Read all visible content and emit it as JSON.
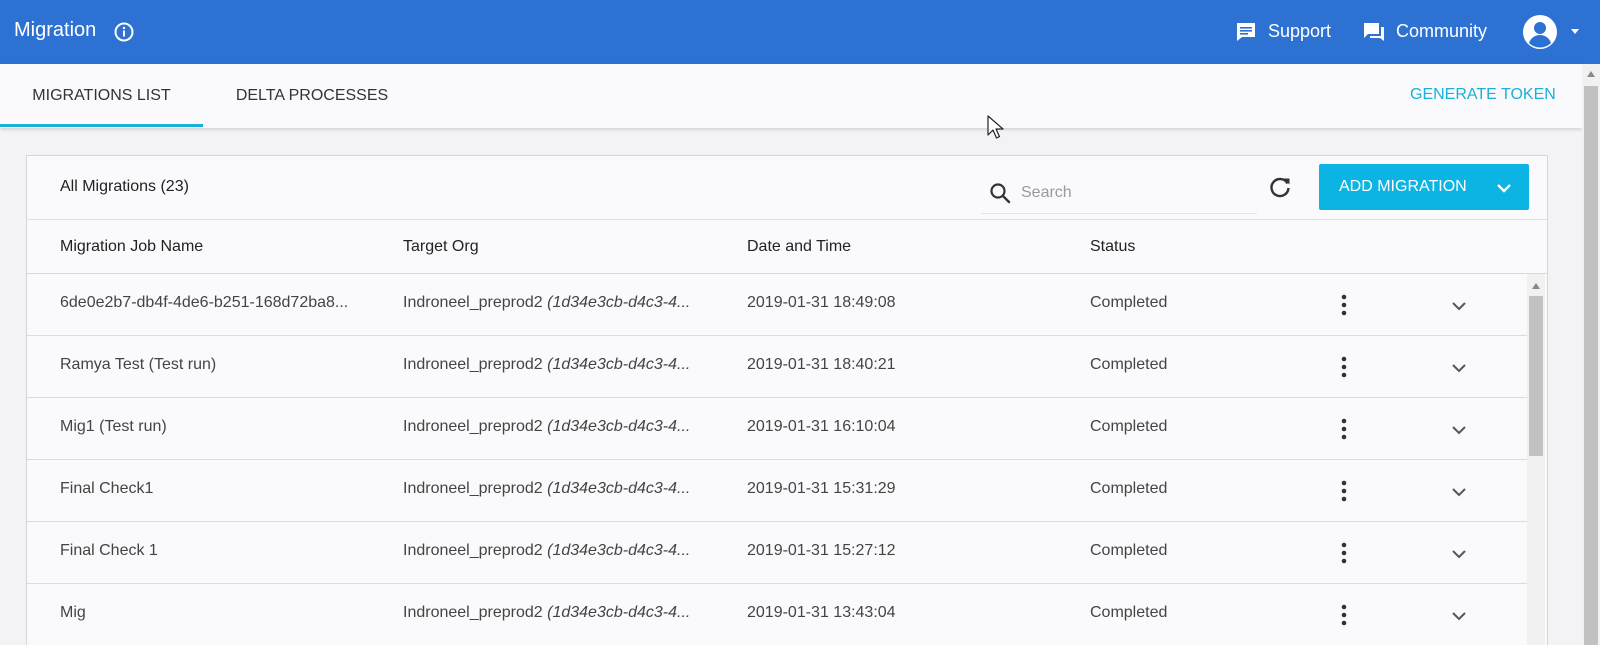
{
  "header": {
    "app_title": "Migration",
    "support_label": "Support",
    "community_label": "Community"
  },
  "tabs": [
    {
      "label": "MIGRATIONS LIST",
      "active": true
    },
    {
      "label": "DELTA PROCESSES",
      "active": false
    }
  ],
  "generate_token_label": "GENERATE TOKEN",
  "card": {
    "title": "All Migrations (23)",
    "search_placeholder": "Search",
    "search_value": "",
    "add_migration_label": "ADD MIGRATION"
  },
  "table": {
    "columns": [
      "Migration Job Name",
      "Target Org",
      "Date and Time",
      "Status"
    ],
    "rows": [
      {
        "name": "6de0e2b7-db4f-4de6-b251-168d72ba8...",
        "org": "Indroneel_preprod2",
        "org_id": "(1d34e3cb-d4c3-4...",
        "date": "2019-01-31 18:49:08",
        "status": "Completed"
      },
      {
        "name": "Ramya Test (Test run)",
        "org": "Indroneel_preprod2",
        "org_id": "(1d34e3cb-d4c3-4...",
        "date": "2019-01-31 18:40:21",
        "status": "Completed"
      },
      {
        "name": "Mig1 (Test run)",
        "org": "Indroneel_preprod2",
        "org_id": "(1d34e3cb-d4c3-4...",
        "date": "2019-01-31 16:10:04",
        "status": "Completed"
      },
      {
        "name": "Final Check1",
        "org": "Indroneel_preprod2",
        "org_id": "(1d34e3cb-d4c3-4...",
        "date": "2019-01-31 15:31:29",
        "status": "Completed"
      },
      {
        "name": "Final Check 1",
        "org": "Indroneel_preprod2",
        "org_id": "(1d34e3cb-d4c3-4...",
        "date": "2019-01-31 15:27:12",
        "status": "Completed"
      },
      {
        "name": "Mig",
        "org": "Indroneel_preprod2",
        "org_id": "(1d34e3cb-d4c3-4...",
        "date": "2019-01-31 13:43:04",
        "status": "Completed"
      }
    ]
  },
  "icons": {
    "info": "info-icon",
    "support": "chat-bubble-icon",
    "community": "forum-icon",
    "avatar": "account-circle-icon",
    "search": "search-icon",
    "refresh": "refresh-icon",
    "row_menu": "kebab-menu-icon",
    "row_expand": "chevron-down-icon"
  },
  "colors": {
    "topbar": "#2d72d2",
    "accent": "#1ab0d8",
    "primary_button": "#0cb4e4"
  }
}
